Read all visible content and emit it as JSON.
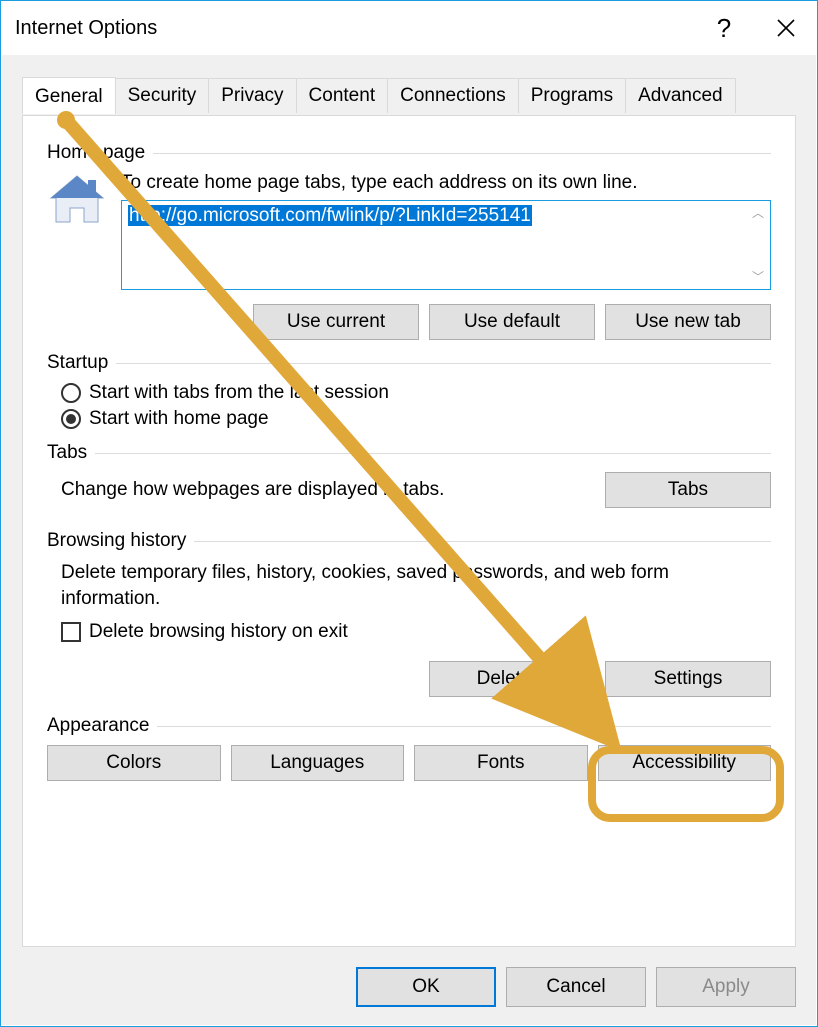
{
  "window": {
    "title": "Internet Options",
    "help_glyph": "?",
    "close_glyph": "✕"
  },
  "tabs": {
    "items": [
      "General",
      "Security",
      "Privacy",
      "Content",
      "Connections",
      "Programs",
      "Advanced"
    ],
    "active_index": 0
  },
  "home_page": {
    "legend": "Home page",
    "instruction": "To create home page tabs, type each address on its own line.",
    "value": "http://go.microsoft.com/fwlink/p/?LinkId=255141",
    "buttons": {
      "use_current": "Use current",
      "use_default": "Use default",
      "use_new_tab": "Use new tab"
    }
  },
  "startup": {
    "legend": "Startup",
    "option_last_session": "Start with tabs from the last session",
    "option_home_page": "Start with home page",
    "selected": "home_page"
  },
  "tabs_section": {
    "legend": "Tabs",
    "description": "Change how webpages are displayed in tabs.",
    "button": "Tabs"
  },
  "browsing_history": {
    "legend": "Browsing history",
    "description": "Delete temporary files, history, cookies, saved passwords, and web form information.",
    "delete_on_exit_label": "Delete browsing history on exit",
    "delete_on_exit_checked": false,
    "buttons": {
      "delete": "Delete...",
      "settings": "Settings"
    }
  },
  "appearance": {
    "legend": "Appearance",
    "buttons": {
      "colors": "Colors",
      "languages": "Languages",
      "fonts": "Fonts",
      "accessibility": "Accessibility"
    }
  },
  "dialog": {
    "ok": "OK",
    "cancel": "Cancel",
    "apply": "Apply"
  },
  "annotation": {
    "type": "arrow-and-highlight",
    "color": "#e0a838",
    "from": "tab-general",
    "to": "browsing-history-settings-button"
  }
}
